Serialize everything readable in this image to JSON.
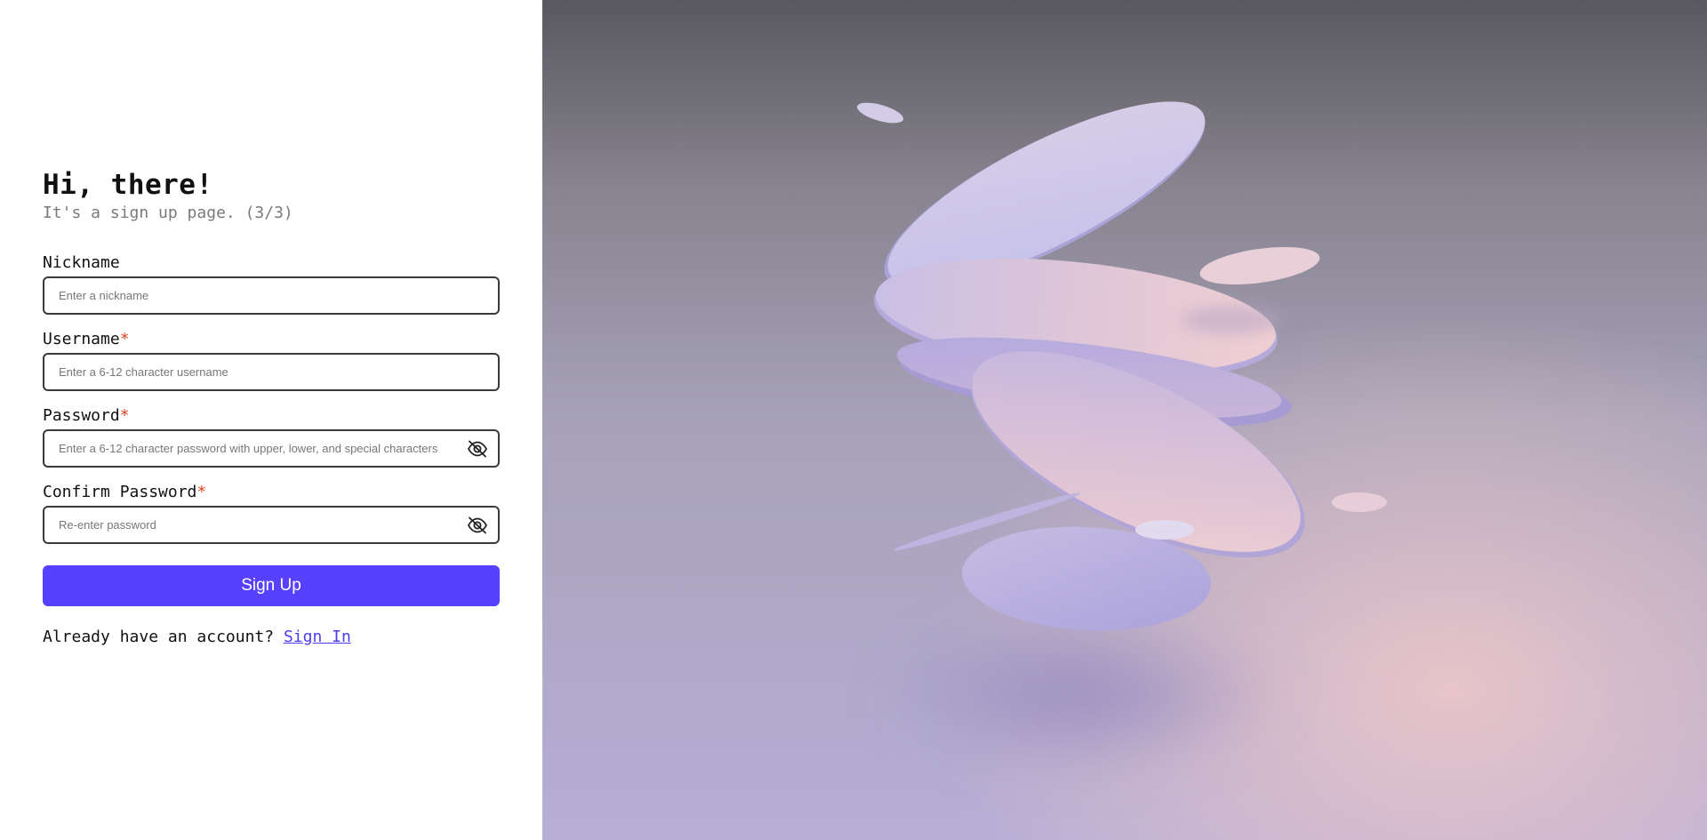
{
  "header": {
    "title": "Hi, there!",
    "subtitle": "It's a sign up page. (3/3)"
  },
  "form": {
    "nickname": {
      "label": "Nickname",
      "placeholder": "Enter a nickname",
      "value": ""
    },
    "username": {
      "label": "Username",
      "required_mark": "*",
      "placeholder": "Enter a 6-12 character username",
      "value": ""
    },
    "password": {
      "label": "Password",
      "required_mark": "*",
      "placeholder": "Enter a 6-12 character password with upper, lower, and special characters",
      "value": "",
      "toggle_icon": "eye-off-icon"
    },
    "confirm_password": {
      "label": "Confirm Password",
      "required_mark": "*",
      "placeholder": "Re-enter password",
      "value": "",
      "toggle_icon": "eye-off-icon"
    },
    "submit_label": "Sign Up"
  },
  "footer": {
    "prompt": "Already have an account? ",
    "link_label": "Sign In"
  },
  "colors": {
    "accent": "#5641ff",
    "required": "#d9441c",
    "link": "#4a3cf0"
  },
  "illustration": {
    "description_icon": "floating-discs-illustration"
  }
}
